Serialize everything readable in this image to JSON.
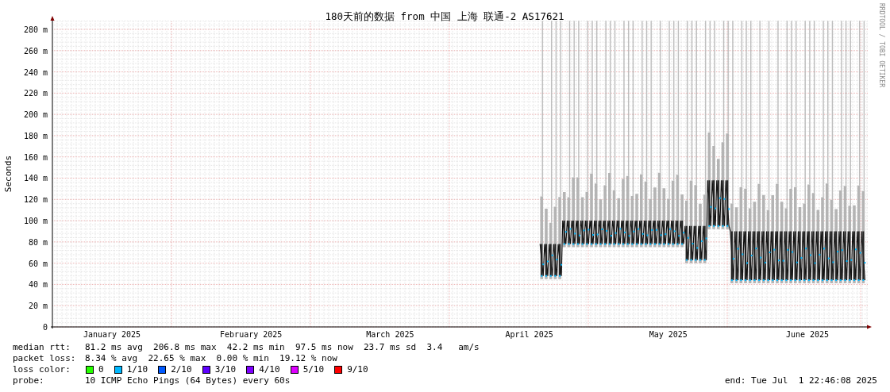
{
  "graph": {
    "title": "180天前的数据 from 中国 上海 联通-2 AS17621",
    "ylabel": "Seconds",
    "watermark": "RRDTOOL / TOBI OETIKER",
    "yticks": [
      "280 m",
      "260 m",
      "240 m",
      "220 m",
      "200 m",
      "180 m",
      "160 m",
      "140 m",
      "120 m",
      "100 m",
      "80 m",
      "60 m",
      "40 m",
      "20 m",
      "0"
    ],
    "months": [
      "January 2025",
      "February 2025",
      "March 2025",
      "April 2025",
      "May 2025",
      "June 2025"
    ]
  },
  "legend": {
    "rtt_label": "median rtt:",
    "rtt": "81.2 ms avg  206.8 ms max  42.2 ms min  97.5 ms now  23.7 ms sd  3.4   am/s",
    "loss_label": "packet loss:",
    "loss": "8.34 % avg  22.65 % max  0.00 % min  19.12 % now",
    "color_label": "loss color:",
    "colors": [
      {
        "label": "0",
        "color": "#26ff00"
      },
      {
        "label": "1/10",
        "color": "#00b8ff"
      },
      {
        "label": "2/10",
        "color": "#0059ff"
      },
      {
        "label": "3/10",
        "color": "#5e00ff"
      },
      {
        "label": "4/10",
        "color": "#7e00ff"
      },
      {
        "label": "5/10",
        "color": "#dd00ff"
      },
      {
        "label": "9/10",
        "color": "#ff0000"
      }
    ],
    "probe_label": "probe:",
    "probe": "10 ICMP Echo Pings (64 Bytes) every 60s",
    "end": "end: Tue Jul  1 22:46:08 2025"
  }
}
